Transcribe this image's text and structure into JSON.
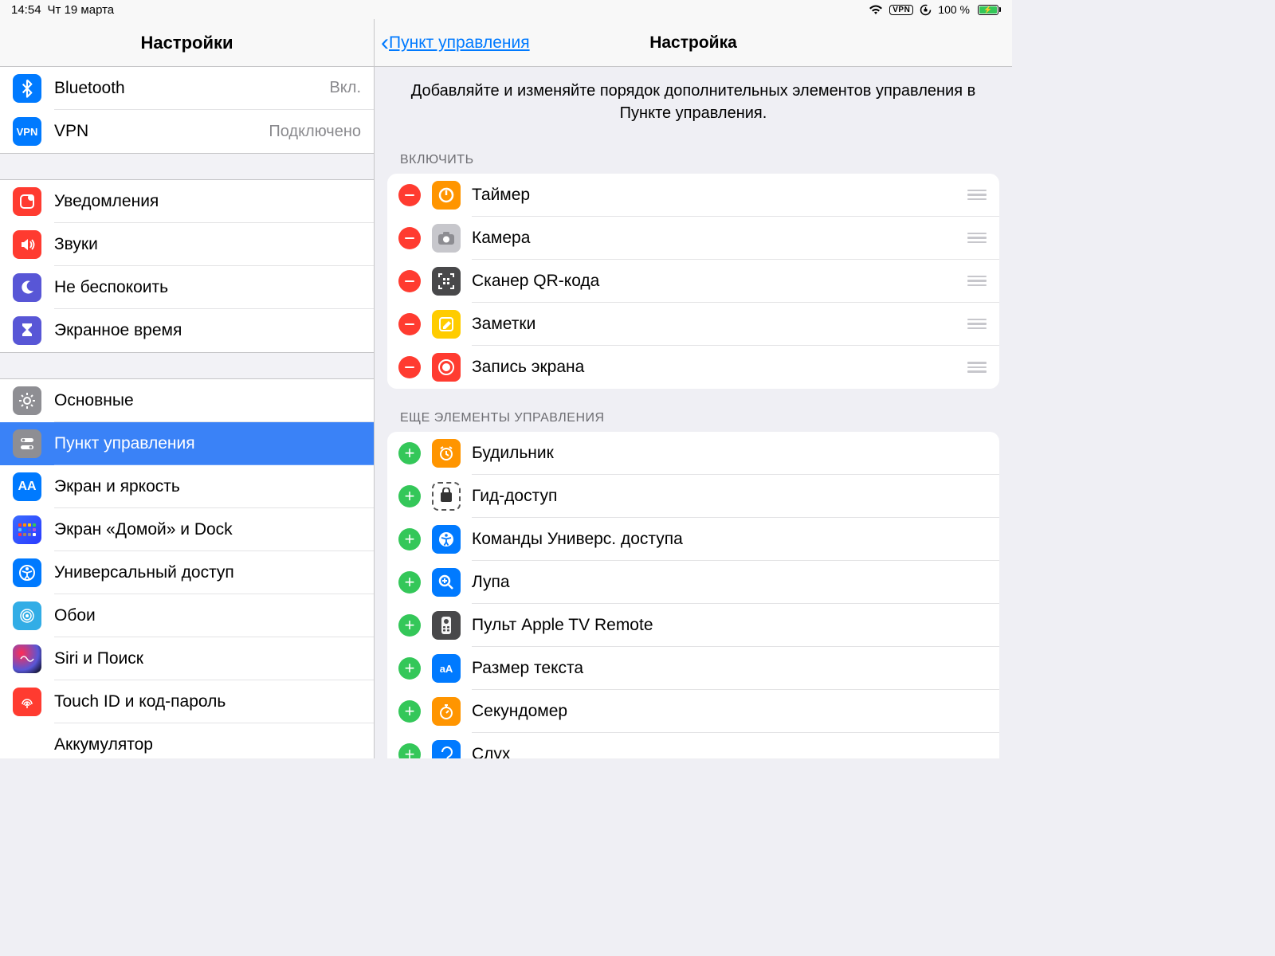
{
  "statusbar": {
    "time": "14:54",
    "date": "Чт 19 марта",
    "vpn": "VPN",
    "battery": "100 %"
  },
  "sidebar": {
    "title": "Настройки",
    "group1": [
      {
        "id": "bluetooth",
        "label": "Bluetooth",
        "status": "Вкл.",
        "icon": "bluetooth",
        "bg": "bg-blue"
      },
      {
        "id": "vpn",
        "label": "VPN",
        "status": "Подключено",
        "icon": "vpn",
        "bg": "bg-blue"
      }
    ],
    "group2": [
      {
        "id": "notifications",
        "label": "Уведомления",
        "icon": "notif",
        "bg": "bg-red"
      },
      {
        "id": "sounds",
        "label": "Звуки",
        "icon": "sound",
        "bg": "bg-red"
      },
      {
        "id": "dnd",
        "label": "Не беспокоить",
        "icon": "moon",
        "bg": "bg-indigo"
      },
      {
        "id": "screentime",
        "label": "Экранное время",
        "icon": "hourglass",
        "bg": "bg-indigo"
      }
    ],
    "group3": [
      {
        "id": "general",
        "label": "Основные",
        "icon": "gear",
        "bg": "bg-gray"
      },
      {
        "id": "control-center",
        "label": "Пункт управления",
        "icon": "toggles",
        "bg": "bg-gray",
        "selected": true
      },
      {
        "id": "display",
        "label": "Экран и яркость",
        "icon": "aa",
        "bg": "bg-blue"
      },
      {
        "id": "home",
        "label": "Экран «Домой» и Dock",
        "icon": "home",
        "bg": "bg-home"
      },
      {
        "id": "accessibility",
        "label": "Универсальный доступ",
        "icon": "access",
        "bg": "bg-blue"
      },
      {
        "id": "wallpaper",
        "label": "Обои",
        "icon": "wall",
        "bg": "bg-cyan"
      },
      {
        "id": "siri",
        "label": "Siri и Поиск",
        "icon": "siri",
        "bg": "bg-siri"
      },
      {
        "id": "touchid",
        "label": "Touch ID и код-пароль",
        "icon": "finger",
        "bg": "bg-red"
      },
      {
        "id": "battery",
        "label": "Аккумулятор",
        "icon": "batt",
        "bg": ""
      }
    ]
  },
  "main": {
    "back": "Пункт управления",
    "title": "Настройка",
    "description": "Добавляйте и изменяйте порядок дополнительных элементов управления в Пункте управления.",
    "section_included": "ВКЛЮЧИТЬ",
    "section_more": "ЕЩЕ ЭЛЕМЕНТЫ УПРАВЛЕНИЯ",
    "included": [
      {
        "id": "timer",
        "label": "Таймер",
        "bg": "bg-orange",
        "glyph": "⏲"
      },
      {
        "id": "camera",
        "label": "Камера",
        "bg": "bg-graylight",
        "glyph": "📷"
      },
      {
        "id": "qr",
        "label": "Сканер QR-кода",
        "bg": "bg-darkgray",
        "glyph": "⎘"
      },
      {
        "id": "notes",
        "label": "Заметки",
        "bg": "bg-yellow",
        "glyph": "✎"
      },
      {
        "id": "record",
        "label": "Запись экрана",
        "bg": "bg-red",
        "glyph": "◉"
      }
    ],
    "more": [
      {
        "id": "alarm",
        "label": "Будильник",
        "bg": "bg-orange",
        "glyph": "⏰"
      },
      {
        "id": "guided",
        "label": "Гид-доступ",
        "bg": "bg-dashed",
        "glyph": "🔒"
      },
      {
        "id": "access-cmd",
        "label": "Команды Универс. доступа",
        "bg": "bg-blue",
        "glyph": "⊕"
      },
      {
        "id": "magnifier",
        "label": "Лупа",
        "bg": "bg-blue",
        "glyph": "🔍"
      },
      {
        "id": "appletv",
        "label": "Пульт Apple TV Remote",
        "bg": "bg-darkgray",
        "glyph": "▭"
      },
      {
        "id": "textsize",
        "label": "Размер текста",
        "bg": "bg-blue",
        "glyph": "аА"
      },
      {
        "id": "stopwatch",
        "label": "Секундомер",
        "bg": "bg-orange",
        "glyph": "⏱"
      },
      {
        "id": "hearing",
        "label": "Слух",
        "bg": "bg-blue",
        "glyph": "👂"
      }
    ]
  }
}
